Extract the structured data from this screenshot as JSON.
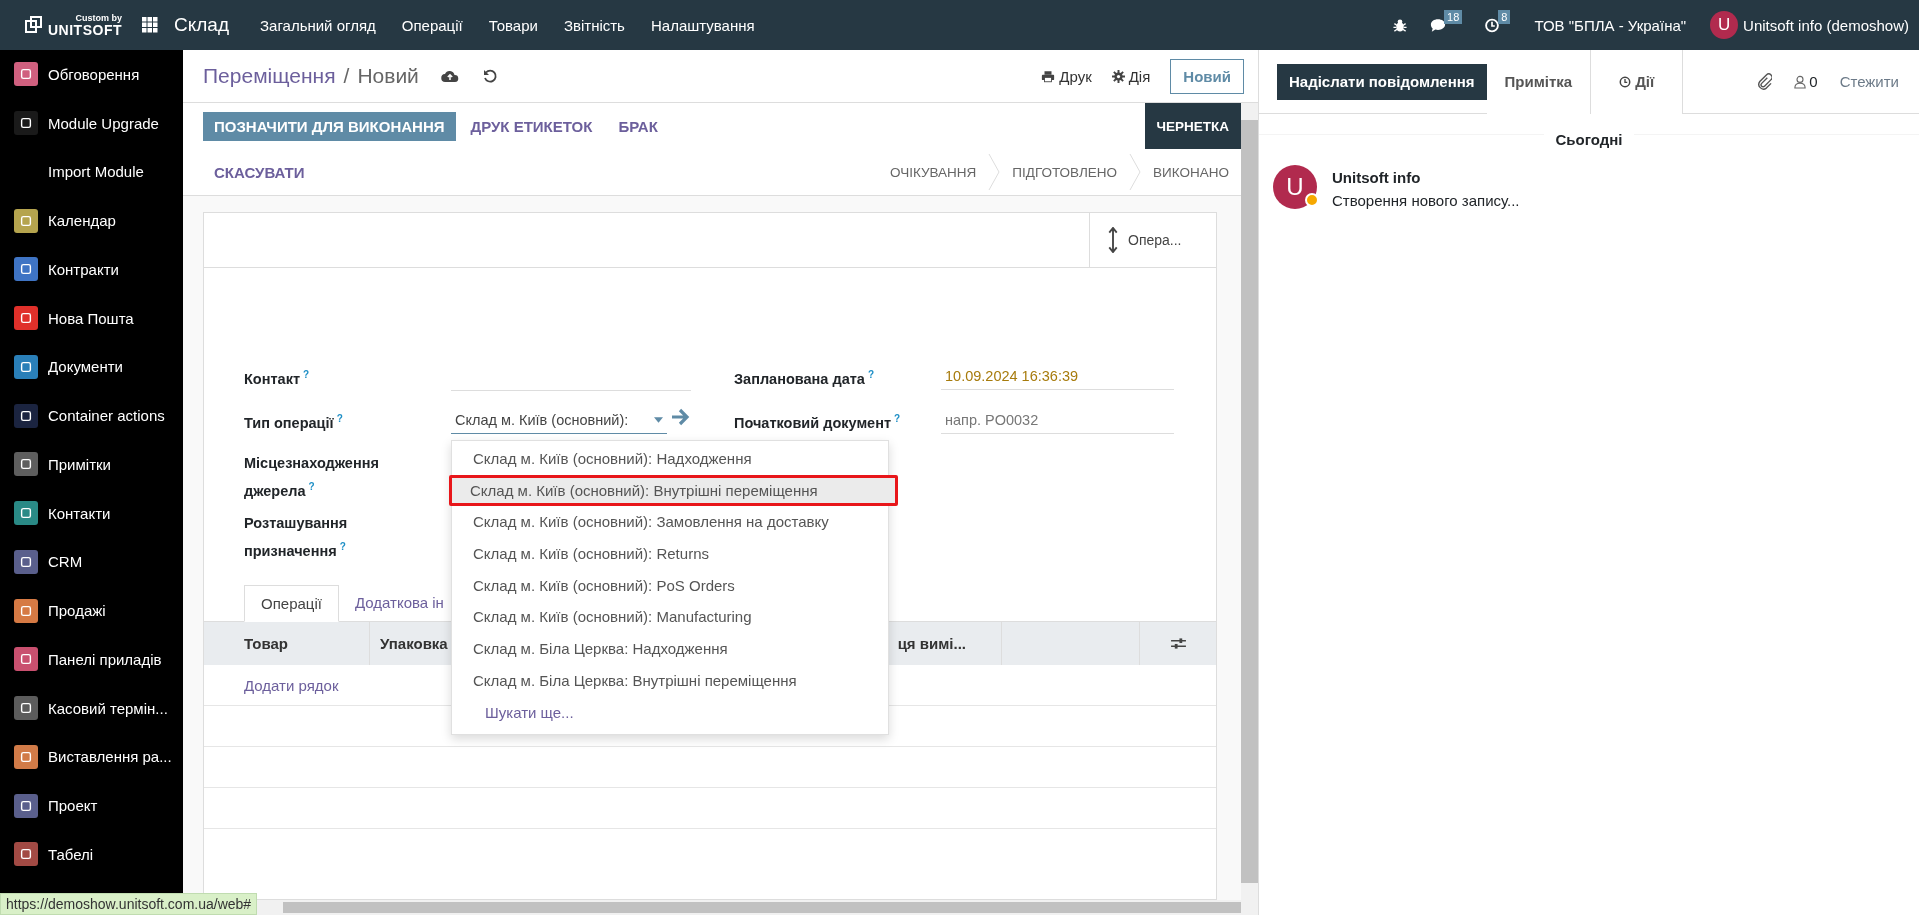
{
  "topbar": {
    "brand_top": "Custom by",
    "brand_name": "UNITSOFT",
    "app": "Склад",
    "menu": [
      "Загальний огляд",
      "Операції",
      "Товари",
      "Звітність",
      "Налаштування"
    ],
    "messages_count": "18",
    "activities_count": "8",
    "company": "ТОВ \"БПЛА - Україна\"",
    "avatar_letter": "U",
    "user": "Unitsoft info (demoshow)"
  },
  "sidebar": {
    "items": [
      {
        "label": "Обговорення",
        "color": "#d0607f"
      },
      {
        "label": "Module Upgrade",
        "color": "#1a1a1a"
      },
      {
        "label": "Import Module"
      },
      {
        "label": "Календар",
        "color": "#b5a44e"
      },
      {
        "label": "Контракти",
        "color": "#3f74c4"
      },
      {
        "label": "Нова Пошта",
        "color": "#e0302a"
      },
      {
        "label": "Документи",
        "color": "#2a7fb8"
      },
      {
        "label": "Container actions",
        "color": "#1b2440"
      },
      {
        "label": "Примітки",
        "color": "#5e5e5e"
      },
      {
        "label": "Контакти",
        "color": "#2a8a86"
      },
      {
        "label": "CRM",
        "color": "#5a5f8c"
      },
      {
        "label": "Продажі",
        "color": "#d67a44"
      },
      {
        "label": "Панелі приладів",
        "color": "#c9506f"
      },
      {
        "label": "Касовий термін...",
        "color": "#5c5c5c"
      },
      {
        "label": "Виставлення ра...",
        "color": "#d17b48"
      },
      {
        "label": "Проект",
        "color": "#5a5f8c"
      },
      {
        "label": "Табелі",
        "color": "#a24a44"
      }
    ]
  },
  "breadcrumb": {
    "parent": "Переміщення",
    "separator": "/",
    "current": "Новий"
  },
  "actions": {
    "print": "Друк",
    "action": "Дія",
    "new": "Новий"
  },
  "buttons": [
    {
      "label": "ПОЗНАЧИТИ ДЛЯ ВИКОНАННЯ",
      "kind": "primary"
    },
    {
      "label": "ДРУК ЕТИКЕТОК",
      "kind": "link"
    },
    {
      "label": "БРАК",
      "kind": "link"
    },
    {
      "label": "СКАСУВАТИ",
      "kind": "link"
    }
  ],
  "stages": [
    {
      "label": "ЧЕРНЕТКА",
      "selected": true
    },
    {
      "label": "ОЧІКУВАННЯ",
      "selected": false
    },
    {
      "label": "ПІДГОТОВЛЕНО",
      "selected": false
    },
    {
      "label": "ВИКОНАНО",
      "selected": false
    }
  ],
  "ops_button": "Опера...",
  "fields_left": [
    {
      "label": "Контакт",
      "help": "?",
      "kind": "empty"
    },
    {
      "label": "Тип операції",
      "help": "?",
      "kind": "select",
      "value": "Склад м. Київ (основний):"
    },
    {
      "label": "Місцезнаходження джерела",
      "help": "?",
      "kind": "blank"
    },
    {
      "label": "Розташування призначення",
      "help": "?",
      "kind": "blank"
    }
  ],
  "fields_right": [
    {
      "label": "Запланована дата",
      "help": "?",
      "value": "10.09.2024 16:36:39"
    },
    {
      "label": "Початковий документ",
      "help": "?",
      "placeholder": "напр. PO0032"
    }
  ],
  "dropdown": {
    "options": [
      {
        "label": "Склад м. Київ (основний): Надходження",
        "selected": false
      },
      {
        "label": "Склад м. Київ (основний): Внутрішні переміщення",
        "selected": true
      },
      {
        "label": "Склад м. Київ (основний): Замовлення на доставку",
        "selected": false
      },
      {
        "label": "Склад м. Київ (основний): Returns",
        "selected": false
      },
      {
        "label": "Склад м. Київ (основний): PoS Orders",
        "selected": false
      },
      {
        "label": "Склад м. Київ (основний): Manufacturing",
        "selected": false
      },
      {
        "label": "Склад м. Біла Церква: Надходження",
        "selected": false
      },
      {
        "label": "Склад м. Біла Церква: Внутрішні переміщення",
        "selected": false
      }
    ],
    "search_more": "Шукати ще..."
  },
  "tabs": [
    {
      "label": "Операції",
      "selected": true
    },
    {
      "label": "Додаткова ін",
      "selected": false
    }
  ],
  "table": {
    "columns": [
      "Товар",
      "Упаковка",
      "ця вимі..."
    ],
    "add_line": "Додати рядок"
  },
  "chatter": {
    "send": "Надіслати повідомлення",
    "note": "Примітка",
    "activities": "Дії",
    "followers_count": "0",
    "follow": "Стежити",
    "date": "Сьогодні",
    "message": {
      "avatar": "U",
      "author": "Unitsoft info",
      "body": "Створення нового запису..."
    }
  },
  "status_url": "https://demoshow.unitsoft.com.ua/web#"
}
